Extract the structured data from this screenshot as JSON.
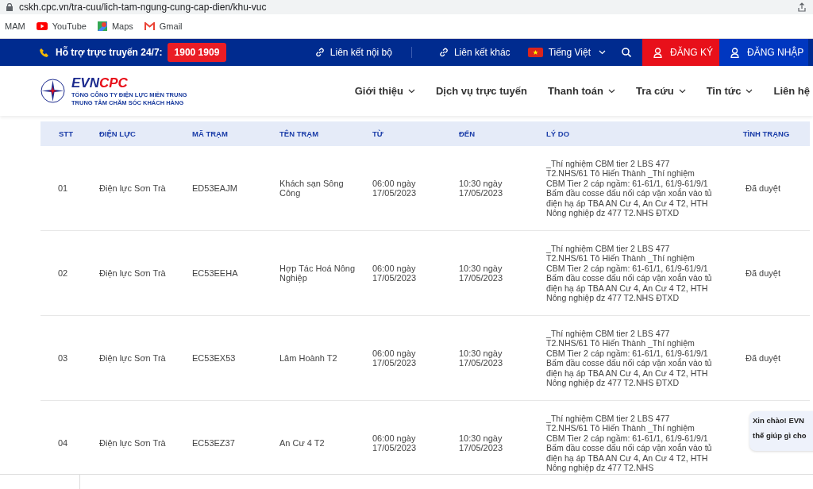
{
  "browser": {
    "url": "cskh.cpc.vn/tra-cuu/lich-tam-ngung-cung-cap-dien/khu-vuc",
    "bookmarks": [
      {
        "label": "MAM",
        "kind": "plain"
      },
      {
        "label": "YouTube",
        "kind": "youtube"
      },
      {
        "label": "Maps",
        "kind": "maps"
      },
      {
        "label": "Gmail",
        "kind": "gmail"
      }
    ]
  },
  "topbar": {
    "support_label": "Hỗ trợ trực truyến 24/7:",
    "hotline": "1900 1909",
    "links": [
      "Liên kết nội bộ",
      "Liên kết khác"
    ],
    "language": "Tiếng Việt",
    "register": "ĐĂNG KÝ",
    "login": "ĐĂNG NHẬP"
  },
  "header": {
    "logo_evn": "EVN",
    "logo_cpc": "CPC",
    "logo_line1": "TỔNG CÔNG TY ĐIỆN LỰC MIỀN TRUNG",
    "logo_line2": "TRUNG TÂM CHĂM SÓC KHÁCH HÀNG",
    "nav": [
      {
        "label": "Giới thiệu",
        "dropdown": true
      },
      {
        "label": "Dịch vụ trực tuyến",
        "dropdown": false
      },
      {
        "label": "Thanh toán",
        "dropdown": true
      },
      {
        "label": "Tra cứu",
        "dropdown": true
      },
      {
        "label": "Tin tức",
        "dropdown": true
      },
      {
        "label": "Liên hệ",
        "dropdown": false
      }
    ]
  },
  "table": {
    "columns": [
      "STT",
      "ĐIỆN LỰC",
      "MÃ TRẠM",
      "TÊN TRẠM",
      "TỪ",
      "ĐẾN",
      "LÝ DO",
      "TÌNH TRẠNG"
    ],
    "rows": [
      [
        "01",
        "Điện lực Sơn Trà",
        "ED53EAJM",
        "Khách sạn Sông Công",
        "06:00 ngày 17/05/2023",
        "10:30 ngày 17/05/2023",
        "_Thí nghiệm CBM tier 2 LBS 477 T2.NHS/61 Tô Hiến Thành _Thí nghiệm CBM Tier 2 cáp ngầm: 61-61/1, 61/9-61/9/1 Bấm đầu cosse đấu nối cáp vặn xoắn vào tủ điện hạ áp TBA AN Cư 4, An Cư 4 T2, HTH Nông nghiệp đz 477 T2.NHS ĐTXD",
        "Đã duyệt"
      ],
      [
        "02",
        "Điện lực Sơn Trà",
        "EC53EEHA",
        "Hợp Tác Hoá Nông Nghiệp",
        "06:00 ngày 17/05/2023",
        "10:30 ngày 17/05/2023",
        "_Thí nghiệm CBM tier 2 LBS 477 T2.NHS/61 Tô Hiến Thành _Thí nghiệm CBM Tier 2 cáp ngầm: 61-61/1, 61/9-61/9/1 Bấm đầu cosse đấu nối cáp vặn xoắn vào tủ điện hạ áp TBA AN Cư 4, An Cư 4 T2, HTH Nông nghiệp đz 477 T2.NHS ĐTXD",
        "Đã duyệt"
      ],
      [
        "03",
        "Điện lực Sơn Trà",
        "EC53EX53",
        "Lâm Hoành T2",
        "06:00 ngày 17/05/2023",
        "10:30 ngày 17/05/2023",
        "_Thí nghiệm CBM tier 2 LBS 477 T2.NHS/61 Tô Hiến Thành _Thí nghiệm CBM Tier 2 cáp ngầm: 61-61/1, 61/9-61/9/1 Bấm đầu cosse đấu nối cáp vặn xoắn vào tủ điện hạ áp TBA AN Cư 4, An Cư 4 T2, HTH Nông nghiệp đz 477 T2.NHS ĐTXD",
        "Đã duyệt"
      ],
      [
        "04",
        "Điện lực Sơn Trà",
        "EC53EZ37",
        "An Cư 4 T2",
        "06:00 ngày 17/05/2023",
        "10:30 ngày 17/05/2023",
        "_Thí nghiệm CBM tier 2 LBS 477 T2.NHS/61 Tô Hiến Thành _Thí nghiệm CBM Tier 2 cáp ngầm: 61-61/1, 61/9-61/9/1 Bấm đầu cosse đấu nối cáp vặn xoắn vào tủ điện hạ áp TBA AN Cư 4, An Cư 4 T2, HTH Nông nghiệp đz 477 T2.NHS"
      ]
    ]
  },
  "chat": {
    "lines": [
      "Xin chào! EVN",
      "thế giúp gì cho"
    ]
  }
}
